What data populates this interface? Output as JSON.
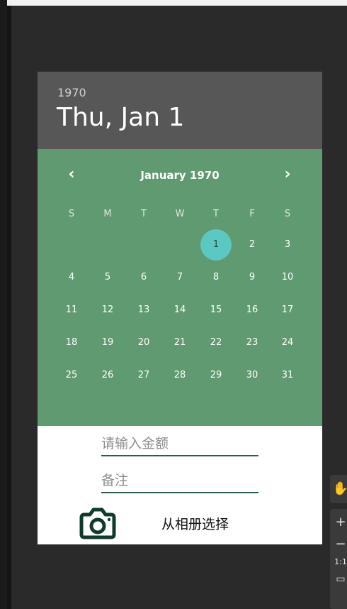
{
  "header": {
    "year": "1970",
    "date_title": "Thu, Jan 1"
  },
  "calendar": {
    "month_title": "January 1970",
    "prev_icon": "‹",
    "next_icon": "›",
    "weekdays": [
      "S",
      "M",
      "T",
      "W",
      "T",
      "F",
      "S"
    ],
    "selected_day": "1",
    "days": [
      "1",
      "2",
      "3",
      "4",
      "5",
      "6",
      "7",
      "8",
      "9",
      "10",
      "11",
      "12",
      "13",
      "14",
      "15",
      "16",
      "17",
      "18",
      "19",
      "20",
      "21",
      "22",
      "23",
      "24",
      "25",
      "26",
      "27",
      "28",
      "29",
      "30",
      "31"
    ]
  },
  "form": {
    "amount_placeholder": "请输入金额",
    "note_placeholder": "备注",
    "album_label": "从相册选择",
    "camera_icon": "camera-icon"
  },
  "side_tools": {
    "hand_icon": "✋",
    "plus_label": "+",
    "minus_label": "−",
    "ratio_label": "1:1",
    "frame_icon": "▭"
  },
  "colors": {
    "header_bg": "#575757",
    "calendar_bg": "#609a70",
    "selected_day_bg": "#5cc8c2",
    "accent": "#2c5c4f"
  }
}
